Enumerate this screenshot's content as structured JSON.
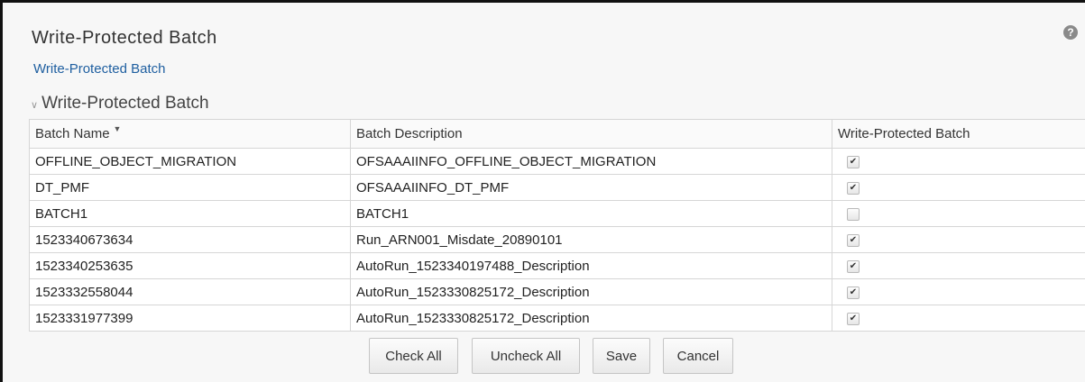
{
  "page": {
    "title": "Write-Protected Batch",
    "help_icon": "?"
  },
  "breadcrumb": "Write-Protected Batch",
  "section": {
    "title": "Write-Protected Batch",
    "expand_icon": "chevron-down-icon"
  },
  "table": {
    "columns": [
      "Batch Name",
      "Batch Description",
      "Write-Protected Batch"
    ],
    "rows": [
      {
        "name": "OFFLINE_OBJECT_MIGRATION",
        "description": "OFSAAAIINFO_OFFLINE_OBJECT_MIGRATION",
        "protected": true
      },
      {
        "name": "DT_PMF",
        "description": "OFSAAAIINFO_DT_PMF",
        "protected": true
      },
      {
        "name": "BATCH1",
        "description": "BATCH1",
        "protected": false
      },
      {
        "name": "1523340673634",
        "description": "Run_ARN001_Misdate_20890101",
        "protected": true
      },
      {
        "name": "1523340253635",
        "description": "AutoRun_1523340197488_Description",
        "protected": true
      },
      {
        "name": "1523332558044",
        "description": "AutoRun_1523330825172_Description",
        "protected": true
      },
      {
        "name": "1523331977399",
        "description": "AutoRun_1523330825172_Description",
        "protected": true
      }
    ]
  },
  "buttons": {
    "check_all": "Check All",
    "uncheck_all": "Uncheck All",
    "save": "Save",
    "cancel": "Cancel"
  }
}
